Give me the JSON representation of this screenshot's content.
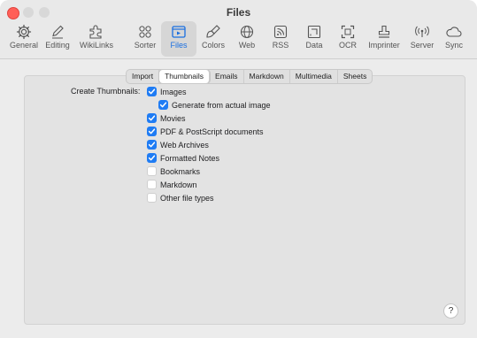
{
  "window": {
    "title": "Files"
  },
  "toolbar": {
    "items": [
      {
        "label": "General",
        "icon": "gear-icon"
      },
      {
        "label": "Editing",
        "icon": "pencil-icon"
      },
      {
        "label": "WikiLinks",
        "icon": "puzzle-icon"
      },
      {
        "label": "Sorter",
        "icon": "dots-grid-icon"
      },
      {
        "label": "Files",
        "icon": "files-icon",
        "active": true
      },
      {
        "label": "Colors",
        "icon": "brush-icon"
      },
      {
        "label": "Web",
        "icon": "globe-icon"
      },
      {
        "label": "RSS",
        "icon": "rss-icon"
      },
      {
        "label": "Data",
        "icon": "data-icon"
      },
      {
        "label": "OCR",
        "icon": "ocr-icon"
      },
      {
        "label": "Imprinter",
        "icon": "stamp-icon"
      },
      {
        "label": "Server",
        "icon": "antenna-icon"
      },
      {
        "label": "Sync",
        "icon": "cloud-icon"
      }
    ]
  },
  "tabs": [
    "Import",
    "Thumbnails",
    "Emails",
    "Markdown",
    "Multimedia",
    "Sheets"
  ],
  "selected_tab": "Thumbnails",
  "thumbnails": {
    "section_label": "Create Thumbnails:",
    "options": [
      {
        "label": "Images",
        "checked": true
      },
      {
        "label": "Generate from actual image",
        "checked": true
      },
      {
        "label": "Movies",
        "checked": true
      },
      {
        "label": "PDF & PostScript documents",
        "checked": true
      },
      {
        "label": "Web Archives",
        "checked": true
      },
      {
        "label": "Formatted Notes",
        "checked": true
      },
      {
        "label": "Bookmarks",
        "checked": false
      },
      {
        "label": "Markdown",
        "checked": false
      },
      {
        "label": "Other file types",
        "checked": false
      }
    ]
  },
  "help": {
    "label": "?"
  },
  "colors": {
    "accent": "#1f7cf4",
    "close": "#ff5f57"
  }
}
